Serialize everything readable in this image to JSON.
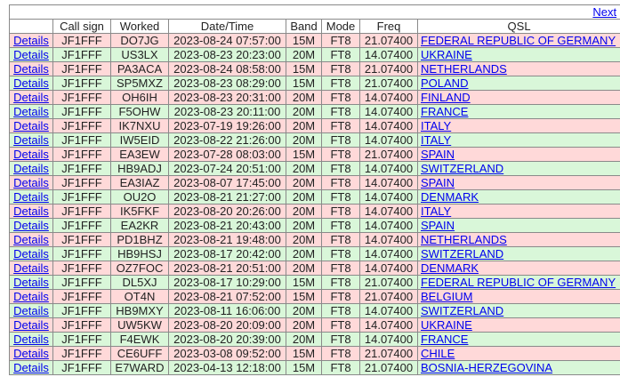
{
  "nav": {
    "next_label": "Next"
  },
  "columns": [
    "",
    "Call sign",
    "Worked",
    "Date/Time",
    "Band",
    "Mode",
    "Freq",
    "QSL"
  ],
  "details_label": "Details",
  "rows": [
    {
      "call": "JF1FFF",
      "worked": "DO7JG",
      "datetime": "2023-08-24 07:57:00",
      "band": "15M",
      "mode": "FT8",
      "freq": "21.07400",
      "qsl": "FEDERAL REPUBLIC OF GERMANY",
      "color": "pink"
    },
    {
      "call": "JF1FFF",
      "worked": "US3LX",
      "datetime": "2023-08-23 20:23:00",
      "band": "20M",
      "mode": "FT8",
      "freq": "14.07400",
      "qsl": "UKRAINE",
      "color": "green"
    },
    {
      "call": "JF1FFF",
      "worked": "PA3ACA",
      "datetime": "2023-08-24 08:58:00",
      "band": "15M",
      "mode": "FT8",
      "freq": "21.07400",
      "qsl": "NETHERLANDS",
      "color": "pink"
    },
    {
      "call": "JF1FFF",
      "worked": "SP5MXZ",
      "datetime": "2023-08-23 08:29:00",
      "band": "15M",
      "mode": "FT8",
      "freq": "21.07400",
      "qsl": "POLAND",
      "color": "green"
    },
    {
      "call": "JF1FFF",
      "worked": "OH6IH",
      "datetime": "2023-08-23 20:31:00",
      "band": "20M",
      "mode": "FT8",
      "freq": "14.07400",
      "qsl": "FINLAND",
      "color": "pink"
    },
    {
      "call": "JF1FFF",
      "worked": "F5OHW",
      "datetime": "2023-08-23 20:11:00",
      "band": "20M",
      "mode": "FT8",
      "freq": "14.07400",
      "qsl": "FRANCE",
      "color": "green"
    },
    {
      "call": "JF1FFF",
      "worked": "IK7NXU",
      "datetime": "2023-07-19 19:26:00",
      "band": "20M",
      "mode": "FT8",
      "freq": "14.07400",
      "qsl": "ITALY",
      "color": "pink"
    },
    {
      "call": "JF1FFF",
      "worked": "IW5EID",
      "datetime": "2023-08-22 21:26:00",
      "band": "20M",
      "mode": "FT8",
      "freq": "14.07400",
      "qsl": "ITALY",
      "color": "green"
    },
    {
      "call": "JF1FFF",
      "worked": "EA3EW",
      "datetime": "2023-07-28 08:03:00",
      "band": "15M",
      "mode": "FT8",
      "freq": "21.07400",
      "qsl": "SPAIN",
      "color": "pink"
    },
    {
      "call": "JF1FFF",
      "worked": "HB9ADJ",
      "datetime": "2023-07-24 20:51:00",
      "band": "20M",
      "mode": "FT8",
      "freq": "14.07400",
      "qsl": "SWITZERLAND",
      "color": "green"
    },
    {
      "call": "JF1FFF",
      "worked": "EA3IAZ",
      "datetime": "2023-08-07 17:45:00",
      "band": "20M",
      "mode": "FT8",
      "freq": "14.07400",
      "qsl": "SPAIN",
      "color": "pink"
    },
    {
      "call": "JF1FFF",
      "worked": "OU2O",
      "datetime": "2023-08-21 21:27:00",
      "band": "20M",
      "mode": "FT8",
      "freq": "14.07400",
      "qsl": "DENMARK",
      "color": "green"
    },
    {
      "call": "JF1FFF",
      "worked": "IK5FKF",
      "datetime": "2023-08-20 20:26:00",
      "band": "20M",
      "mode": "FT8",
      "freq": "14.07400",
      "qsl": "ITALY",
      "color": "pink"
    },
    {
      "call": "JF1FFF",
      "worked": "EA2KR",
      "datetime": "2023-08-21 20:43:00",
      "band": "20M",
      "mode": "FT8",
      "freq": "14.07400",
      "qsl": "SPAIN",
      "color": "green"
    },
    {
      "call": "JF1FFF",
      "worked": "PD1BHZ",
      "datetime": "2023-08-21 19:48:00",
      "band": "20M",
      "mode": "FT8",
      "freq": "14.07400",
      "qsl": "NETHERLANDS",
      "color": "pink"
    },
    {
      "call": "JF1FFF",
      "worked": "HB9HSJ",
      "datetime": "2023-08-17 20:42:00",
      "band": "20M",
      "mode": "FT8",
      "freq": "14.07400",
      "qsl": "SWITZERLAND",
      "color": "green"
    },
    {
      "call": "JF1FFF",
      "worked": "OZ7FOC",
      "datetime": "2023-08-21 20:51:00",
      "band": "20M",
      "mode": "FT8",
      "freq": "14.07400",
      "qsl": "DENMARK",
      "color": "pink"
    },
    {
      "call": "JF1FFF",
      "worked": "DL5XJ",
      "datetime": "2023-08-17 10:29:00",
      "band": "15M",
      "mode": "FT8",
      "freq": "21.07400",
      "qsl": "FEDERAL REPUBLIC OF GERMANY",
      "color": "green"
    },
    {
      "call": "JF1FFF",
      "worked": "OT4N",
      "datetime": "2023-08-21 07:52:00",
      "band": "15M",
      "mode": "FT8",
      "freq": "21.07400",
      "qsl": "BELGIUM",
      "color": "pink"
    },
    {
      "call": "JF1FFF",
      "worked": "HB9MXY",
      "datetime": "2023-08-11 16:06:00",
      "band": "20M",
      "mode": "FT8",
      "freq": "14.07400",
      "qsl": "SWITZERLAND",
      "color": "green"
    },
    {
      "call": "JF1FFF",
      "worked": "UW5KW",
      "datetime": "2023-08-20 20:09:00",
      "band": "20M",
      "mode": "FT8",
      "freq": "14.07400",
      "qsl": "UKRAINE",
      "color": "pink"
    },
    {
      "call": "JF1FFF",
      "worked": "F4EWK",
      "datetime": "2023-08-20 20:39:00",
      "band": "20M",
      "mode": "FT8",
      "freq": "14.07400",
      "qsl": "FRANCE",
      "color": "green"
    },
    {
      "call": "JF1FFF",
      "worked": "CE6UFF",
      "datetime": "2023-03-08 09:52:00",
      "band": "15M",
      "mode": "FT8",
      "freq": "21.07400",
      "qsl": "CHILE",
      "color": "pink"
    },
    {
      "call": "JF1FFF",
      "worked": "E7WARD",
      "datetime": "2023-04-13 12:18:00",
      "band": "15M",
      "mode": "FT8",
      "freq": "21.07400",
      "qsl": "BOSNIA-HERZEGOVINA",
      "color": "green"
    }
  ]
}
